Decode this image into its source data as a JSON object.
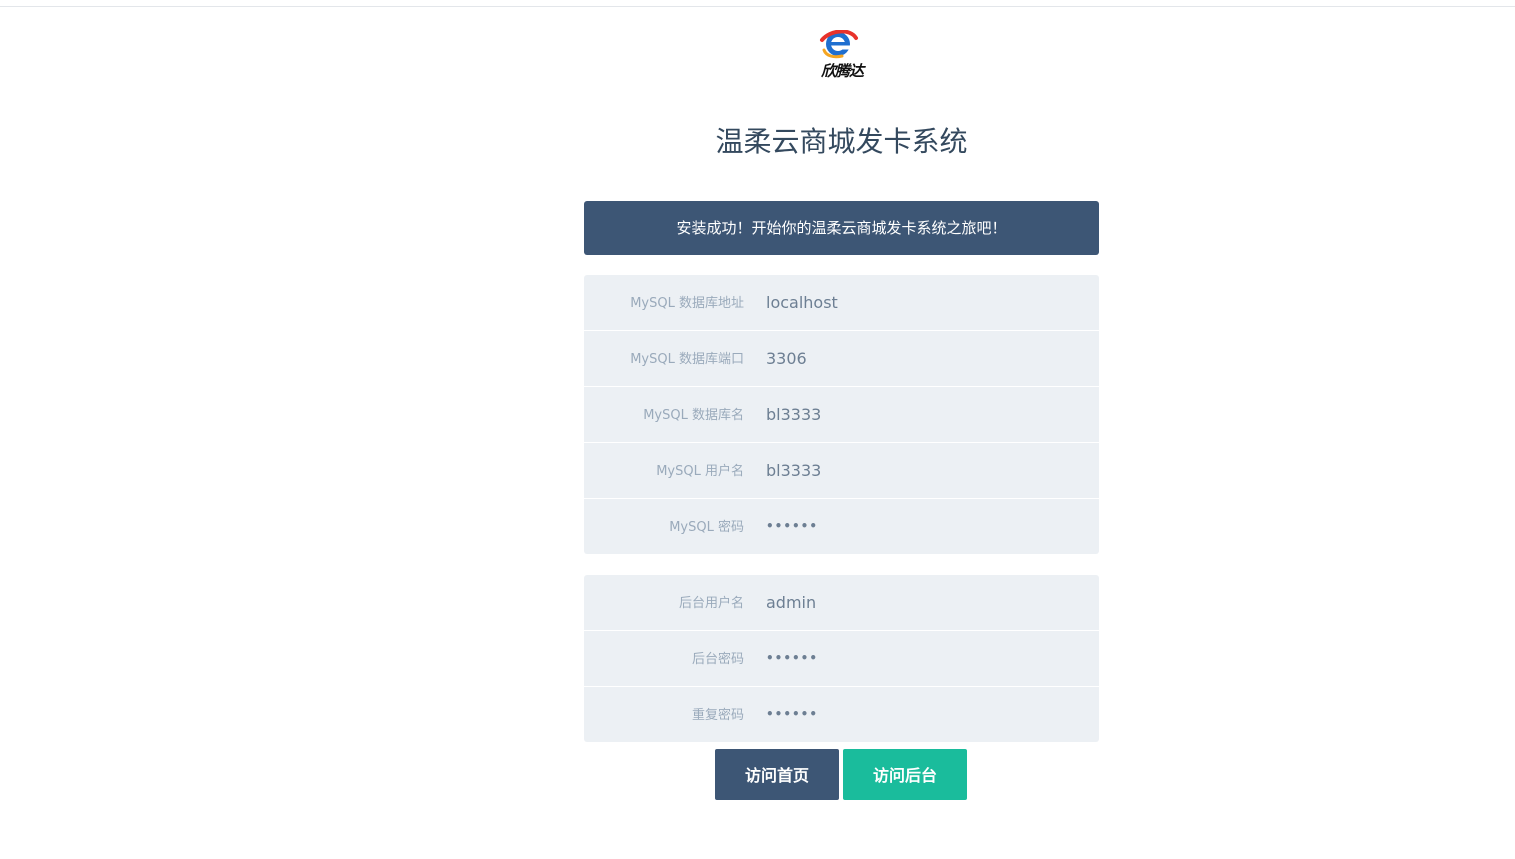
{
  "logo": {
    "icon": "ie-style-e-logo-icon",
    "text": "欣腾达"
  },
  "title": "温柔云商城发卡系统",
  "banner": "安装成功！开始你的温柔云商城发卡系统之旅吧！",
  "database": {
    "host_label": "MySQL 数据库地址",
    "host_value": "localhost",
    "port_label": "MySQL 数据库端口",
    "port_value": "3306",
    "name_label": "MySQL 数据库名",
    "name_value": "bl3333",
    "user_label": "MySQL 用户名",
    "user_value": "bl3333",
    "password_label": "MySQL 密码",
    "password_value": "••••••"
  },
  "admin": {
    "user_label": "后台用户名",
    "user_value": "admin",
    "password_label": "后台密码",
    "password_value": "••••••",
    "repeat_label": "重复密码",
    "repeat_value": "••••••"
  },
  "buttons": {
    "home": "访问首页",
    "admin": "访问后台"
  },
  "colors": {
    "primary": "#3d5675",
    "success": "#1abc9c",
    "title": "#34495e",
    "field_bg": "#ecf0f4"
  }
}
